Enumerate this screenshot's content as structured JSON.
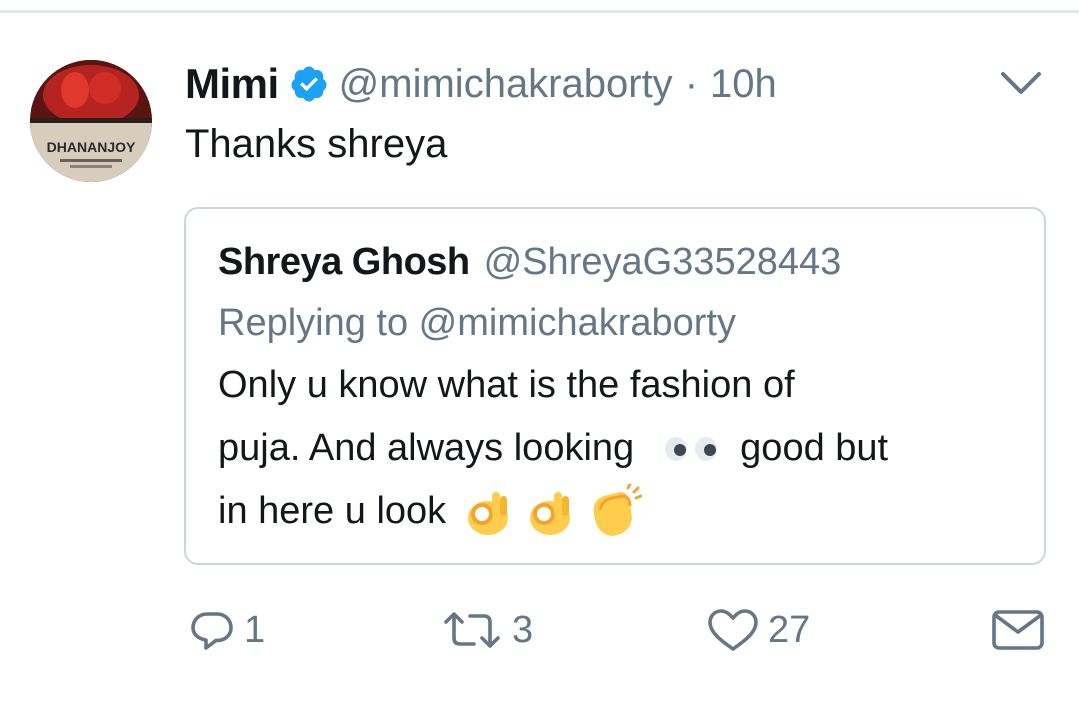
{
  "tweet": {
    "display_name": "Mimi",
    "verified": true,
    "handle": "@mimichakraborty",
    "separator": "·",
    "time": "10h",
    "text": "Thanks shreya",
    "avatar_text": "DHANANJOY"
  },
  "quoted": {
    "display_name": "Shreya Ghosh",
    "handle": "@ShreyaG33528443",
    "replying_to": "Replying to @mimichakraborty",
    "line1": "Only  u know  what  is the  fashion  of",
    "line2_a": "puja. And always  looking",
    "line2_b": "good but",
    "line3": "in here u look",
    "emojis": [
      "eyes-emoji",
      "ok-hand-emoji",
      "ok-hand-emoji",
      "clapping-hands-emoji"
    ]
  },
  "actions": {
    "reply_count": "1",
    "retweet_count": "3",
    "like_count": "27"
  },
  "colors": {
    "text_primary": "#14171a",
    "text_secondary": "#657786",
    "verified_blue": "#1da1f2",
    "border": "#ccd6dd"
  },
  "icons": [
    "verified-badge-icon",
    "chevron-down-icon",
    "reply-icon",
    "retweet-icon",
    "like-icon",
    "direct-message-icon"
  ]
}
